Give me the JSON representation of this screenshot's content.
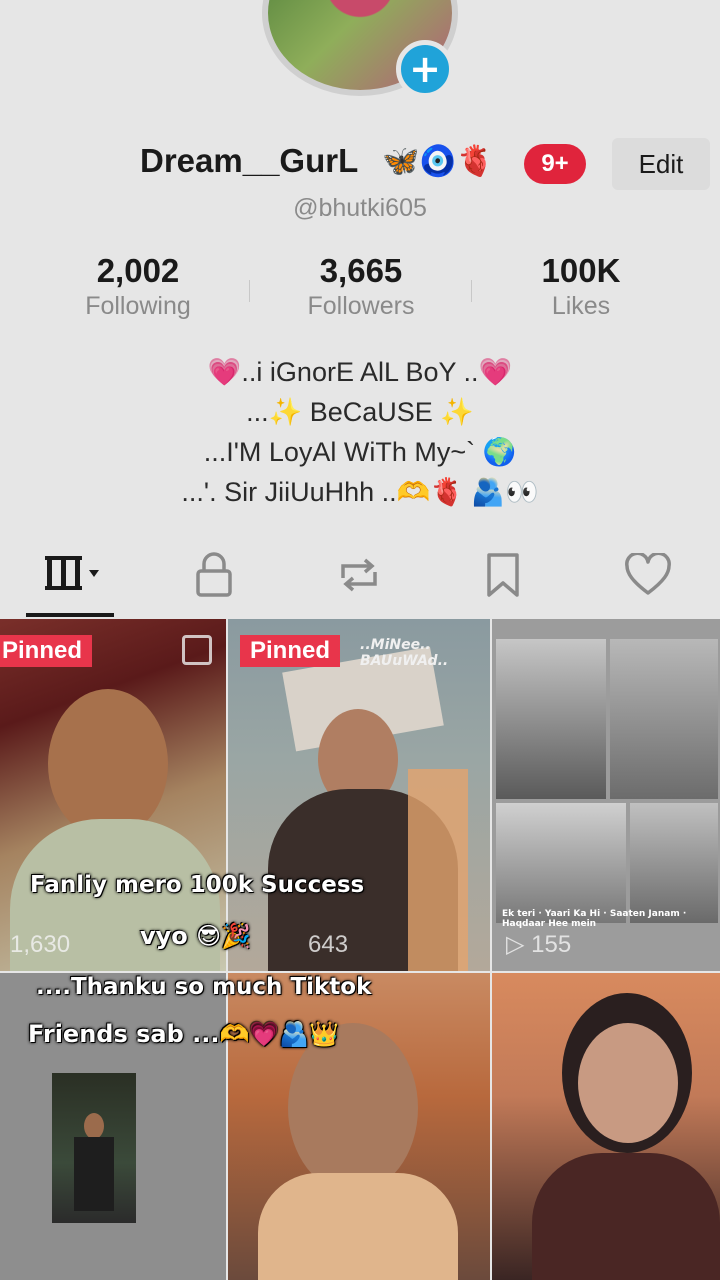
{
  "profile": {
    "display_name": "Dream__GurL",
    "name_emojis": "🦋🧿🫀",
    "notification_badge": "9+",
    "edit_label": "Edit",
    "username": "@bhutki605",
    "add_icon": "plus-icon",
    "stats": [
      {
        "value": "2,002",
        "label": "Following"
      },
      {
        "value": "3,665",
        "label": "Followers"
      },
      {
        "value": "100K",
        "label": "Likes"
      }
    ],
    "bio": [
      "💗..i iGnorE AlL BoY ..💗",
      "...✨ BeCaUSE ✨",
      "...I'M LoyAl WiTh My~` 🌍",
      "...'. Sir JiiUuHhh ..🫶🫀 🫂👀"
    ]
  },
  "tabs": [
    {
      "name": "videos",
      "icon": "grid-bars-icon"
    },
    {
      "name": "private",
      "icon": "lock-icon"
    },
    {
      "name": "reposts",
      "icon": "repost-icon"
    },
    {
      "name": "favorites",
      "icon": "bookmark-icon"
    },
    {
      "name": "liked",
      "icon": "heart-icon"
    }
  ],
  "videos": [
    {
      "pinned": "Pinned",
      "views": "1,630",
      "overlay_text": ""
    },
    {
      "pinned": "Pinned",
      "views": "643",
      "overlay_text": "..MiNee.. BAUuWAd.."
    },
    {
      "pinned": "",
      "views": "155",
      "overlay_text": "Ek teri · Yaari Ka Hi · Saaten Janam · Haqdaar Hee mein"
    },
    {
      "pinned": "",
      "views": "",
      "overlay_text": ""
    },
    {
      "pinned": "",
      "views": "",
      "overlay_text": ""
    },
    {
      "pinned": "",
      "views": "",
      "overlay_text": ""
    }
  ],
  "caption_overlay": {
    "lines": [
      "Fanliy mero 100k Success",
      "vyo 😎🎉",
      "....Thanku so much Tiktok",
      "Friends sab ...🫶💗🫂👑"
    ]
  },
  "colors": {
    "background": "#e6e6e6",
    "accent_badge": "#e0243c",
    "pinned_label": "#e8354b",
    "add_button": "#20a3d9"
  }
}
